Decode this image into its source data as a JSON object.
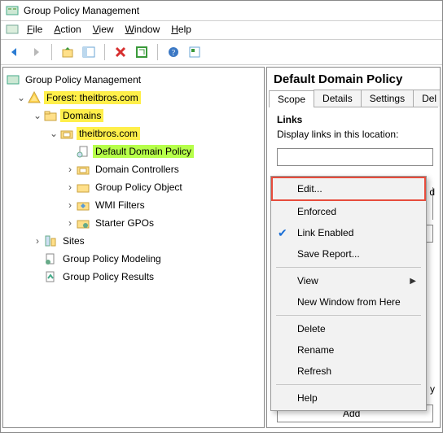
{
  "title": "Group Policy Management",
  "menu": {
    "file": "File",
    "action": "Action",
    "view": "View",
    "window": "Window",
    "help": "Help"
  },
  "tree": {
    "root": "Group Policy Management",
    "forest": "Forest: theitbros.com",
    "domains": "Domains",
    "domain": "theitbros.com",
    "ddp": "Default Domain Policy",
    "dc": "Domain Controllers",
    "gpo": "Group Policy Object",
    "wmi": "WMI Filters",
    "starter": "Starter GPOs",
    "sites": "Sites",
    "modeling": "Group Policy Modeling",
    "results": "Group Policy Results"
  },
  "right": {
    "title": "Default Domain Policy",
    "tabs": {
      "scope": "Scope",
      "details": "Details",
      "settings": "Settings",
      "delegation": "Del"
    },
    "links": "Links",
    "links_desc": "Display links in this location:",
    "bottom_add": "Add",
    "side_y": "y"
  },
  "ctx": {
    "edit": "Edit...",
    "enforced": "Enforced",
    "linkenabled": "Link Enabled",
    "save": "Save Report...",
    "view": "View",
    "newwin": "New Window from Here",
    "delete": "Delete",
    "rename": "Rename",
    "refresh": "Refresh",
    "help": "Help"
  }
}
